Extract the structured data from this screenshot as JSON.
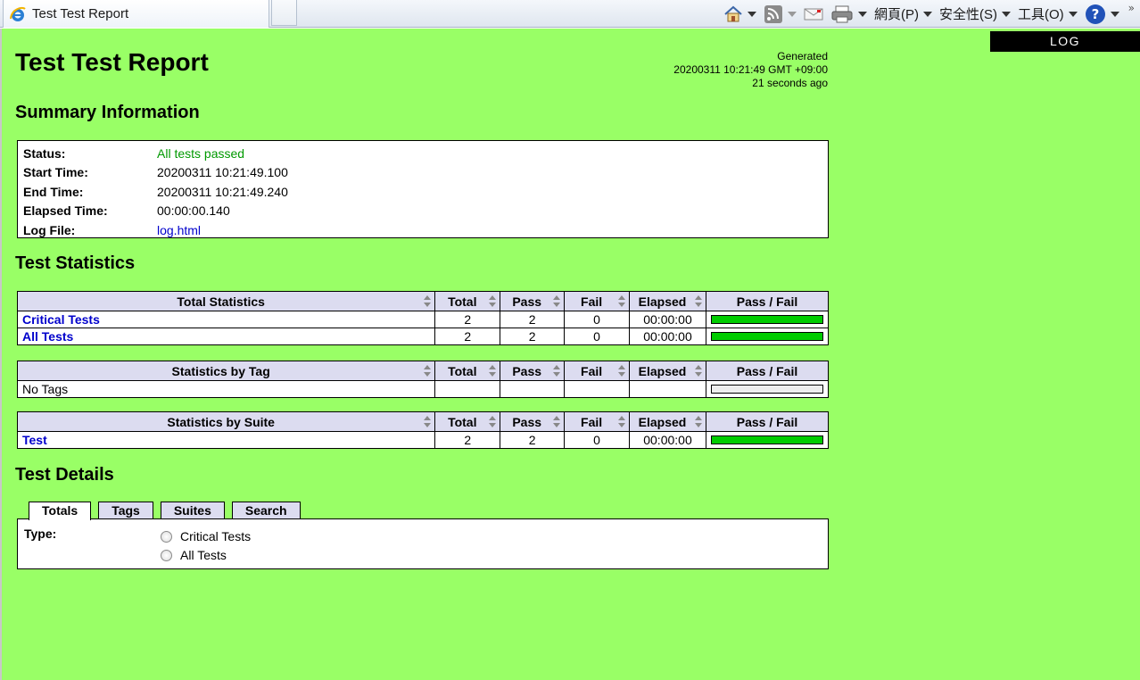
{
  "browser": {
    "tab_title": "Test Test Report",
    "menus": [
      "網頁(P)",
      "安全性(S)",
      "工具(O)"
    ]
  },
  "page": {
    "log_button": "LOG",
    "title": "Test Test Report",
    "generated": {
      "label": "Generated",
      "timestamp": "20200311 10:21:49 GMT +09:00",
      "ago": "21 seconds ago"
    },
    "summary": {
      "heading": "Summary Information",
      "rows": [
        {
          "key": "Status:",
          "value": "All tests passed"
        },
        {
          "key": "Start Time:",
          "value": "20200311 10:21:49.100"
        },
        {
          "key": "End Time:",
          "value": "20200311 10:21:49.240"
        },
        {
          "key": "Elapsed Time:",
          "value": "00:00:00.140"
        },
        {
          "key": "Log File:",
          "value": "log.html"
        }
      ]
    },
    "statistics": {
      "heading": "Test Statistics",
      "columns": [
        "Total",
        "Pass",
        "Fail",
        "Elapsed",
        "Pass / Fail"
      ],
      "total": {
        "header": "Total Statistics",
        "rows": [
          {
            "name": "Critical Tests",
            "total": "2",
            "pass": "2",
            "fail": "0",
            "elapsed": "00:00:00",
            "pass_ratio": 1
          },
          {
            "name": "All Tests",
            "total": "2",
            "pass": "2",
            "fail": "0",
            "elapsed": "00:00:00",
            "pass_ratio": 1
          }
        ]
      },
      "by_tag": {
        "header": "Statistics by Tag",
        "rows": [
          {
            "name": "No Tags",
            "total": "",
            "pass": "",
            "fail": "",
            "elapsed": "",
            "pass_ratio": 0
          }
        ]
      },
      "by_suite": {
        "header": "Statistics by Suite",
        "rows": [
          {
            "name": "Test",
            "total": "2",
            "pass": "2",
            "fail": "0",
            "elapsed": "00:00:00",
            "pass_ratio": 1
          }
        ]
      }
    },
    "details": {
      "heading": "Test Details",
      "tabs": [
        "Totals",
        "Tags",
        "Suites",
        "Search"
      ],
      "active_tab": "Totals",
      "type_label": "Type:",
      "options": [
        "Critical Tests",
        "All Tests"
      ]
    },
    "colors": {
      "background": "#99ff66",
      "pass": "#00cc00",
      "header": "#dcdcf0"
    }
  }
}
